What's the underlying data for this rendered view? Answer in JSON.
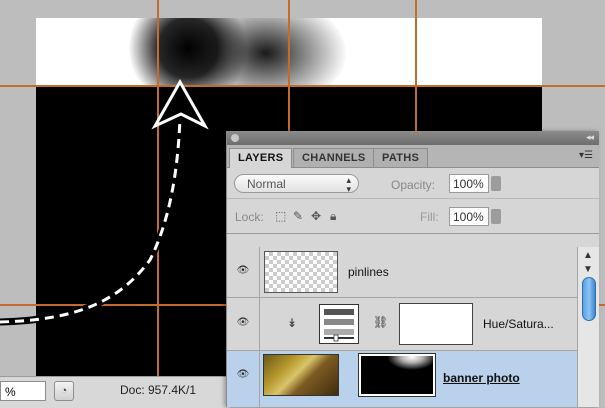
{
  "status_bar": {
    "zoom": "%",
    "doc_info": "Doc: 957.4K/1"
  },
  "layers_panel": {
    "tabs": [
      "LAYERS",
      "CHANNELS",
      "PATHS"
    ],
    "blend_mode": "Normal",
    "opacity_label": "Opacity:",
    "opacity_value": "100%",
    "lock_label": "Lock:",
    "fill_label": "Fill:",
    "fill_value": "100%",
    "layers": [
      {
        "name": "pinlines",
        "type": "raster",
        "selected": false
      },
      {
        "name": "Hue/Satura...",
        "type": "adjustment",
        "selected": false
      },
      {
        "name": "banner photo",
        "type": "photo-with-mask",
        "selected": true
      }
    ]
  },
  "icons": [
    "eye-icon",
    "chain-link-icon",
    "lock-icon",
    "move-icon",
    "brush-icon",
    "clip-arrow-icon",
    "panel-menu-icon"
  ],
  "colors": {
    "guide": "#c46b2e",
    "selected_layer": "#b9d1ea",
    "scroll_thumb": "#5aa0e0"
  }
}
